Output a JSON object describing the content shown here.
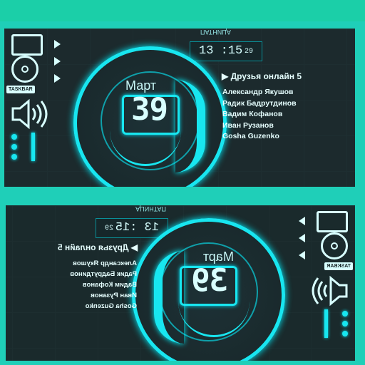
{
  "widget": {
    "header_caption": "ПАТНИЦА",
    "clock": {
      "time": "13 :15",
      "seconds": "29"
    },
    "date": {
      "month": "Март",
      "day": "39"
    },
    "taskbar_label": "TASKBAR",
    "friends": {
      "title": "Друзья онлайн",
      "count": "5",
      "names": [
        "Александр Якушов",
        "Радик Бадрутдинов",
        "Вадим Кофанов",
        "Иван Рузанов",
        "Gosha Guzenko"
      ]
    },
    "icons": [
      "ipod-icon",
      "disc-icon",
      "speaker-icon",
      "play-arrow-icon"
    ],
    "colors": {
      "accent": "#18e6f0",
      "panel": "#1c2a2d",
      "background": "#1fcfb8"
    }
  }
}
